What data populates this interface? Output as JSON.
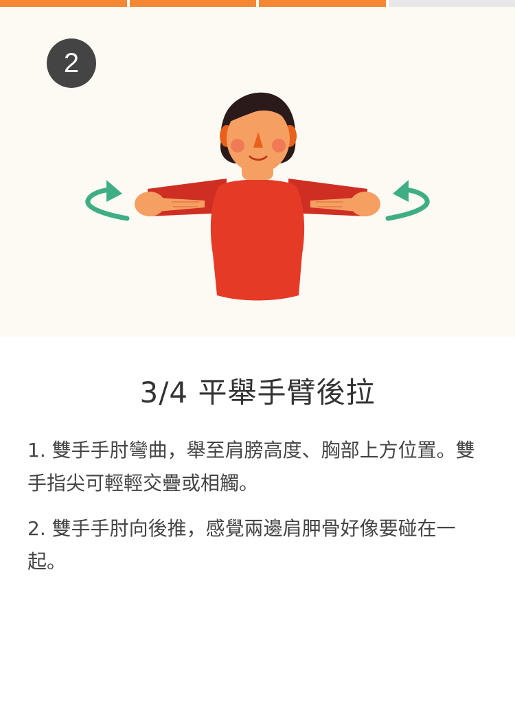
{
  "progress": {
    "segments": [
      {
        "state": "done",
        "color": "#f58634"
      },
      {
        "state": "done",
        "color": "#f58634"
      },
      {
        "state": "current",
        "color": "#f58634"
      },
      {
        "state": "pending",
        "color": "#e8e8e8"
      }
    ]
  },
  "step": {
    "badge_number": "2"
  },
  "illustration": {
    "name": "person-arms-raised-pull-back",
    "colors": {
      "shirt": "#e53a26",
      "skin": "#f5a062",
      "hair": "#2b1a1a",
      "arrow": "#3fae84",
      "background": "#fdfaf3"
    }
  },
  "exercise": {
    "title": "3/4 平舉手臂後拉",
    "instructions": [
      "1. 雙手手肘彎曲，舉至肩膀高度、胸部上方位置。雙手指尖可輕輕交疊或相觸。",
      "2. 雙手手肘向後推，感覺兩邊肩胛骨好像要碰在一起。"
    ]
  }
}
